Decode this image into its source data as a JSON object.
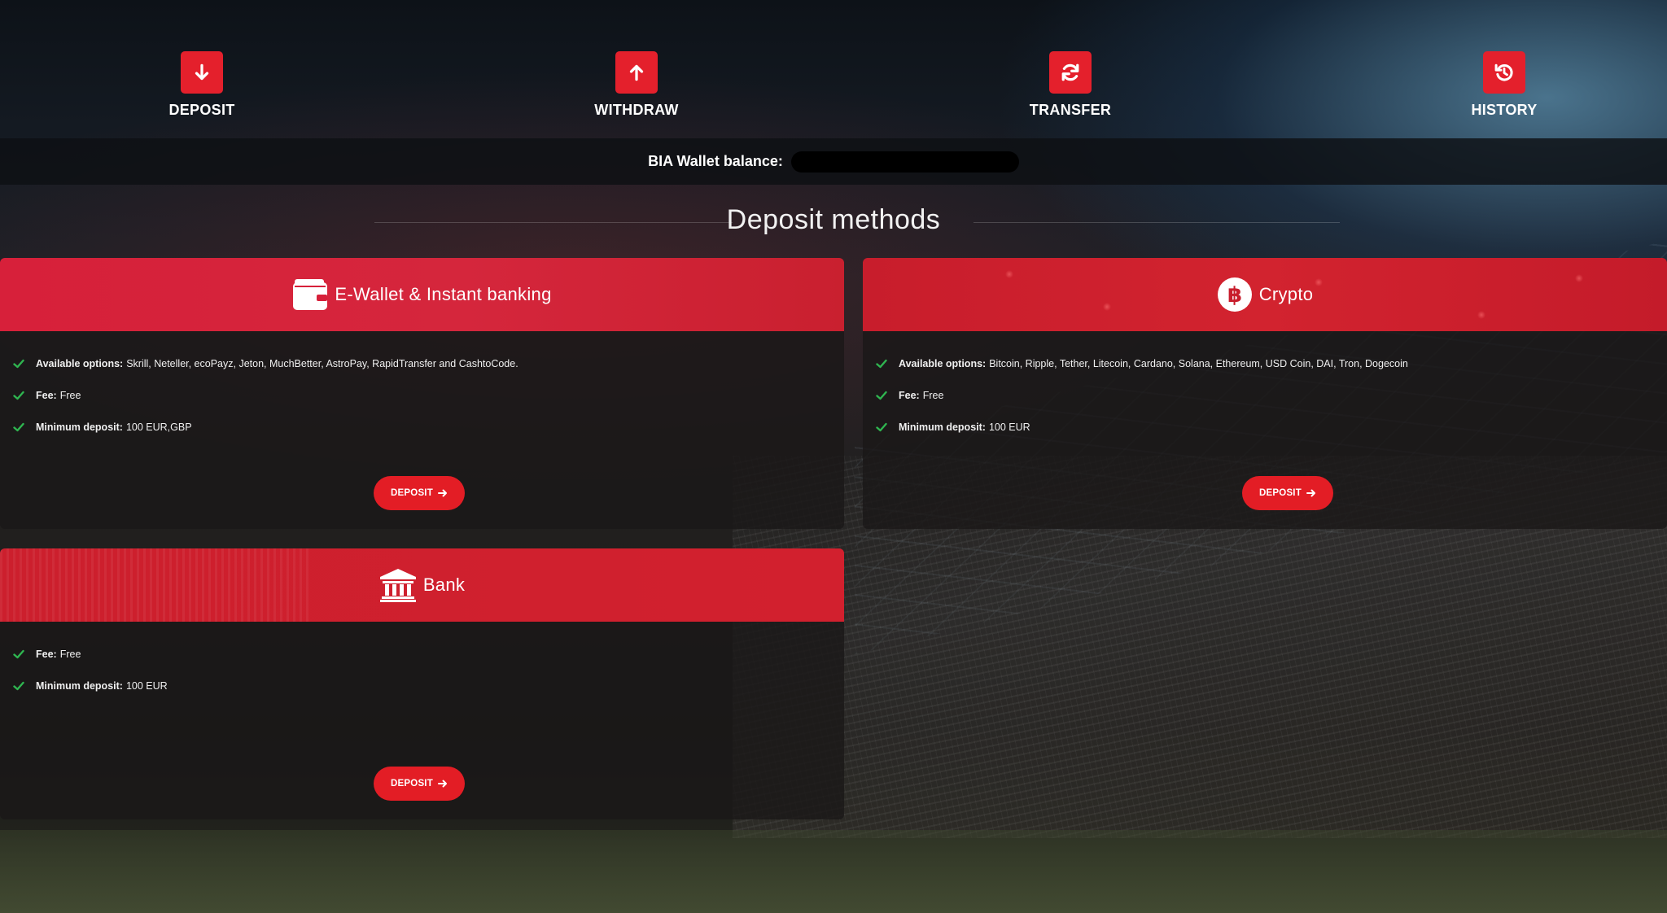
{
  "nav": {
    "items": [
      {
        "label": "DEPOSIT",
        "icon": "arrow-down-icon"
      },
      {
        "label": "WITHDRAW",
        "icon": "arrow-up-icon"
      },
      {
        "label": "TRANSFER",
        "icon": "refresh-icon"
      },
      {
        "label": "HISTORY",
        "icon": "history-icon"
      }
    ]
  },
  "balance": {
    "label": "BIA Wallet balance:",
    "value": ""
  },
  "section_title": "Deposit methods",
  "methods": [
    {
      "title": "E-Wallet & Instant banking",
      "icon": "wallet-icon",
      "features": [
        {
          "key": "Available options:",
          "value": "Skrill, Neteller, ecoPayz, Jeton, MuchBetter, AstroPay, RapidTransfer and CashtoCode."
        },
        {
          "key": "Fee:",
          "value": "Free"
        },
        {
          "key": "Minimum deposit:",
          "value": "100 EUR,GBP"
        }
      ],
      "button_label": "DEPOSIT"
    },
    {
      "title": "Crypto",
      "icon": "bitcoin-icon",
      "features": [
        {
          "key": "Available options:",
          "value": "Bitcoin, Ripple, Tether, Litecoin, Cardano, Solana, Ethereum, USD Coin, DAI, Tron, Dogecoin"
        },
        {
          "key": "Fee:",
          "value": "Free"
        },
        {
          "key": "Minimum deposit:",
          "value": "100 EUR"
        }
      ],
      "button_label": "DEPOSIT"
    },
    {
      "title": "Bank",
      "icon": "bank-icon",
      "features": [
        {
          "key": "Fee:",
          "value": "Free"
        },
        {
          "key": "Minimum deposit:",
          "value": "100 EUR"
        }
      ],
      "button_label": "DEPOSIT"
    }
  ],
  "colors": {
    "accent": "#e4202c",
    "check": "#2fb550",
    "card_bg": "#1a1818"
  }
}
